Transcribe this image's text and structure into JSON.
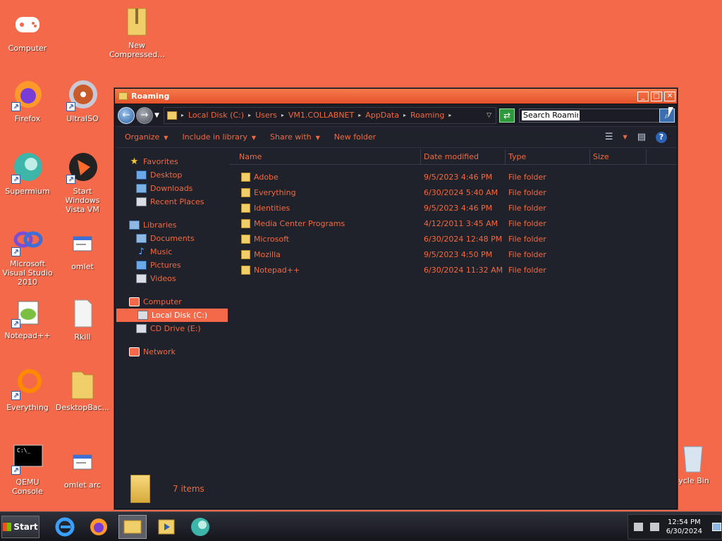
{
  "desktop_icons": [
    {
      "label": "Computer"
    },
    {
      "label": "New Compressed..."
    },
    {
      "label": "Firefox"
    },
    {
      "label": "UltraISO"
    },
    {
      "label": "Supermium"
    },
    {
      "label": "Start Windows Vista VM"
    },
    {
      "label": "Microsoft Visual Studio 2010"
    },
    {
      "label": "omlet"
    },
    {
      "label": "Notepad++"
    },
    {
      "label": "Rkill"
    },
    {
      "label": "Everything"
    },
    {
      "label": "DesktopBac..."
    },
    {
      "label": "QEMU Console"
    },
    {
      "label": "omlet arc"
    },
    {
      "label": "cycle Bin"
    }
  ],
  "window": {
    "title": "Roaming",
    "controls": {
      "minimize": "_",
      "maximize": "□",
      "close": "✕"
    }
  },
  "address": {
    "back": "←",
    "forward": "→",
    "crumbs": [
      "Local Disk (C:)",
      "Users",
      "VM1.COLLABNET",
      "AppData",
      "Roaming"
    ],
    "search_value": "Search Roaming",
    "refresh_glyph": "⇄",
    "search_glyph": "⌕"
  },
  "toolbar": {
    "organize": "Organize",
    "include_in_library": "Include in library",
    "share_with": "Share with",
    "new_folder": "New folder",
    "help": "?"
  },
  "navpane": {
    "favorites": {
      "label": "Favorites",
      "items": [
        "Desktop",
        "Downloads",
        "Recent Places"
      ]
    },
    "libraries": {
      "label": "Libraries",
      "items": [
        "Documents",
        "Music",
        "Pictures",
        "Videos"
      ]
    },
    "computer": {
      "label": "Computer",
      "items": [
        "Local Disk (C:)",
        "CD Drive (E:)"
      ],
      "selected": "Local Disk (C:)"
    },
    "network": {
      "label": "Network"
    }
  },
  "columns": {
    "name": "Name",
    "date": "Date modified",
    "type": "Type",
    "size": "Size"
  },
  "files": [
    {
      "name": "Adobe",
      "date": "9/5/2023 4:46 PM",
      "type": "File folder"
    },
    {
      "name": "Everything",
      "date": "6/30/2024 5:40 AM",
      "type": "File folder"
    },
    {
      "name": "Identities",
      "date": "9/5/2023 4:46 PM",
      "type": "File folder"
    },
    {
      "name": "Media Center Programs",
      "date": "4/12/2011 3:45 AM",
      "type": "File folder"
    },
    {
      "name": "Microsoft",
      "date": "6/30/2024 12:48 PM",
      "type": "File folder"
    },
    {
      "name": "Mozilla",
      "date": "9/5/2023 4:50 PM",
      "type": "File folder"
    },
    {
      "name": "Notepad++",
      "date": "6/30/2024 11:32 AM",
      "type": "File folder"
    }
  ],
  "status": {
    "item_count": "7 items"
  },
  "taskbar": {
    "start_label": "Start",
    "clock_time": "12:54 PM",
    "clock_date": "6/30/2024"
  },
  "colors": {
    "desktop": "#f4694a",
    "window_bg": "#20222b",
    "accent_text": "#f2693f",
    "selection": "#f4694a"
  }
}
